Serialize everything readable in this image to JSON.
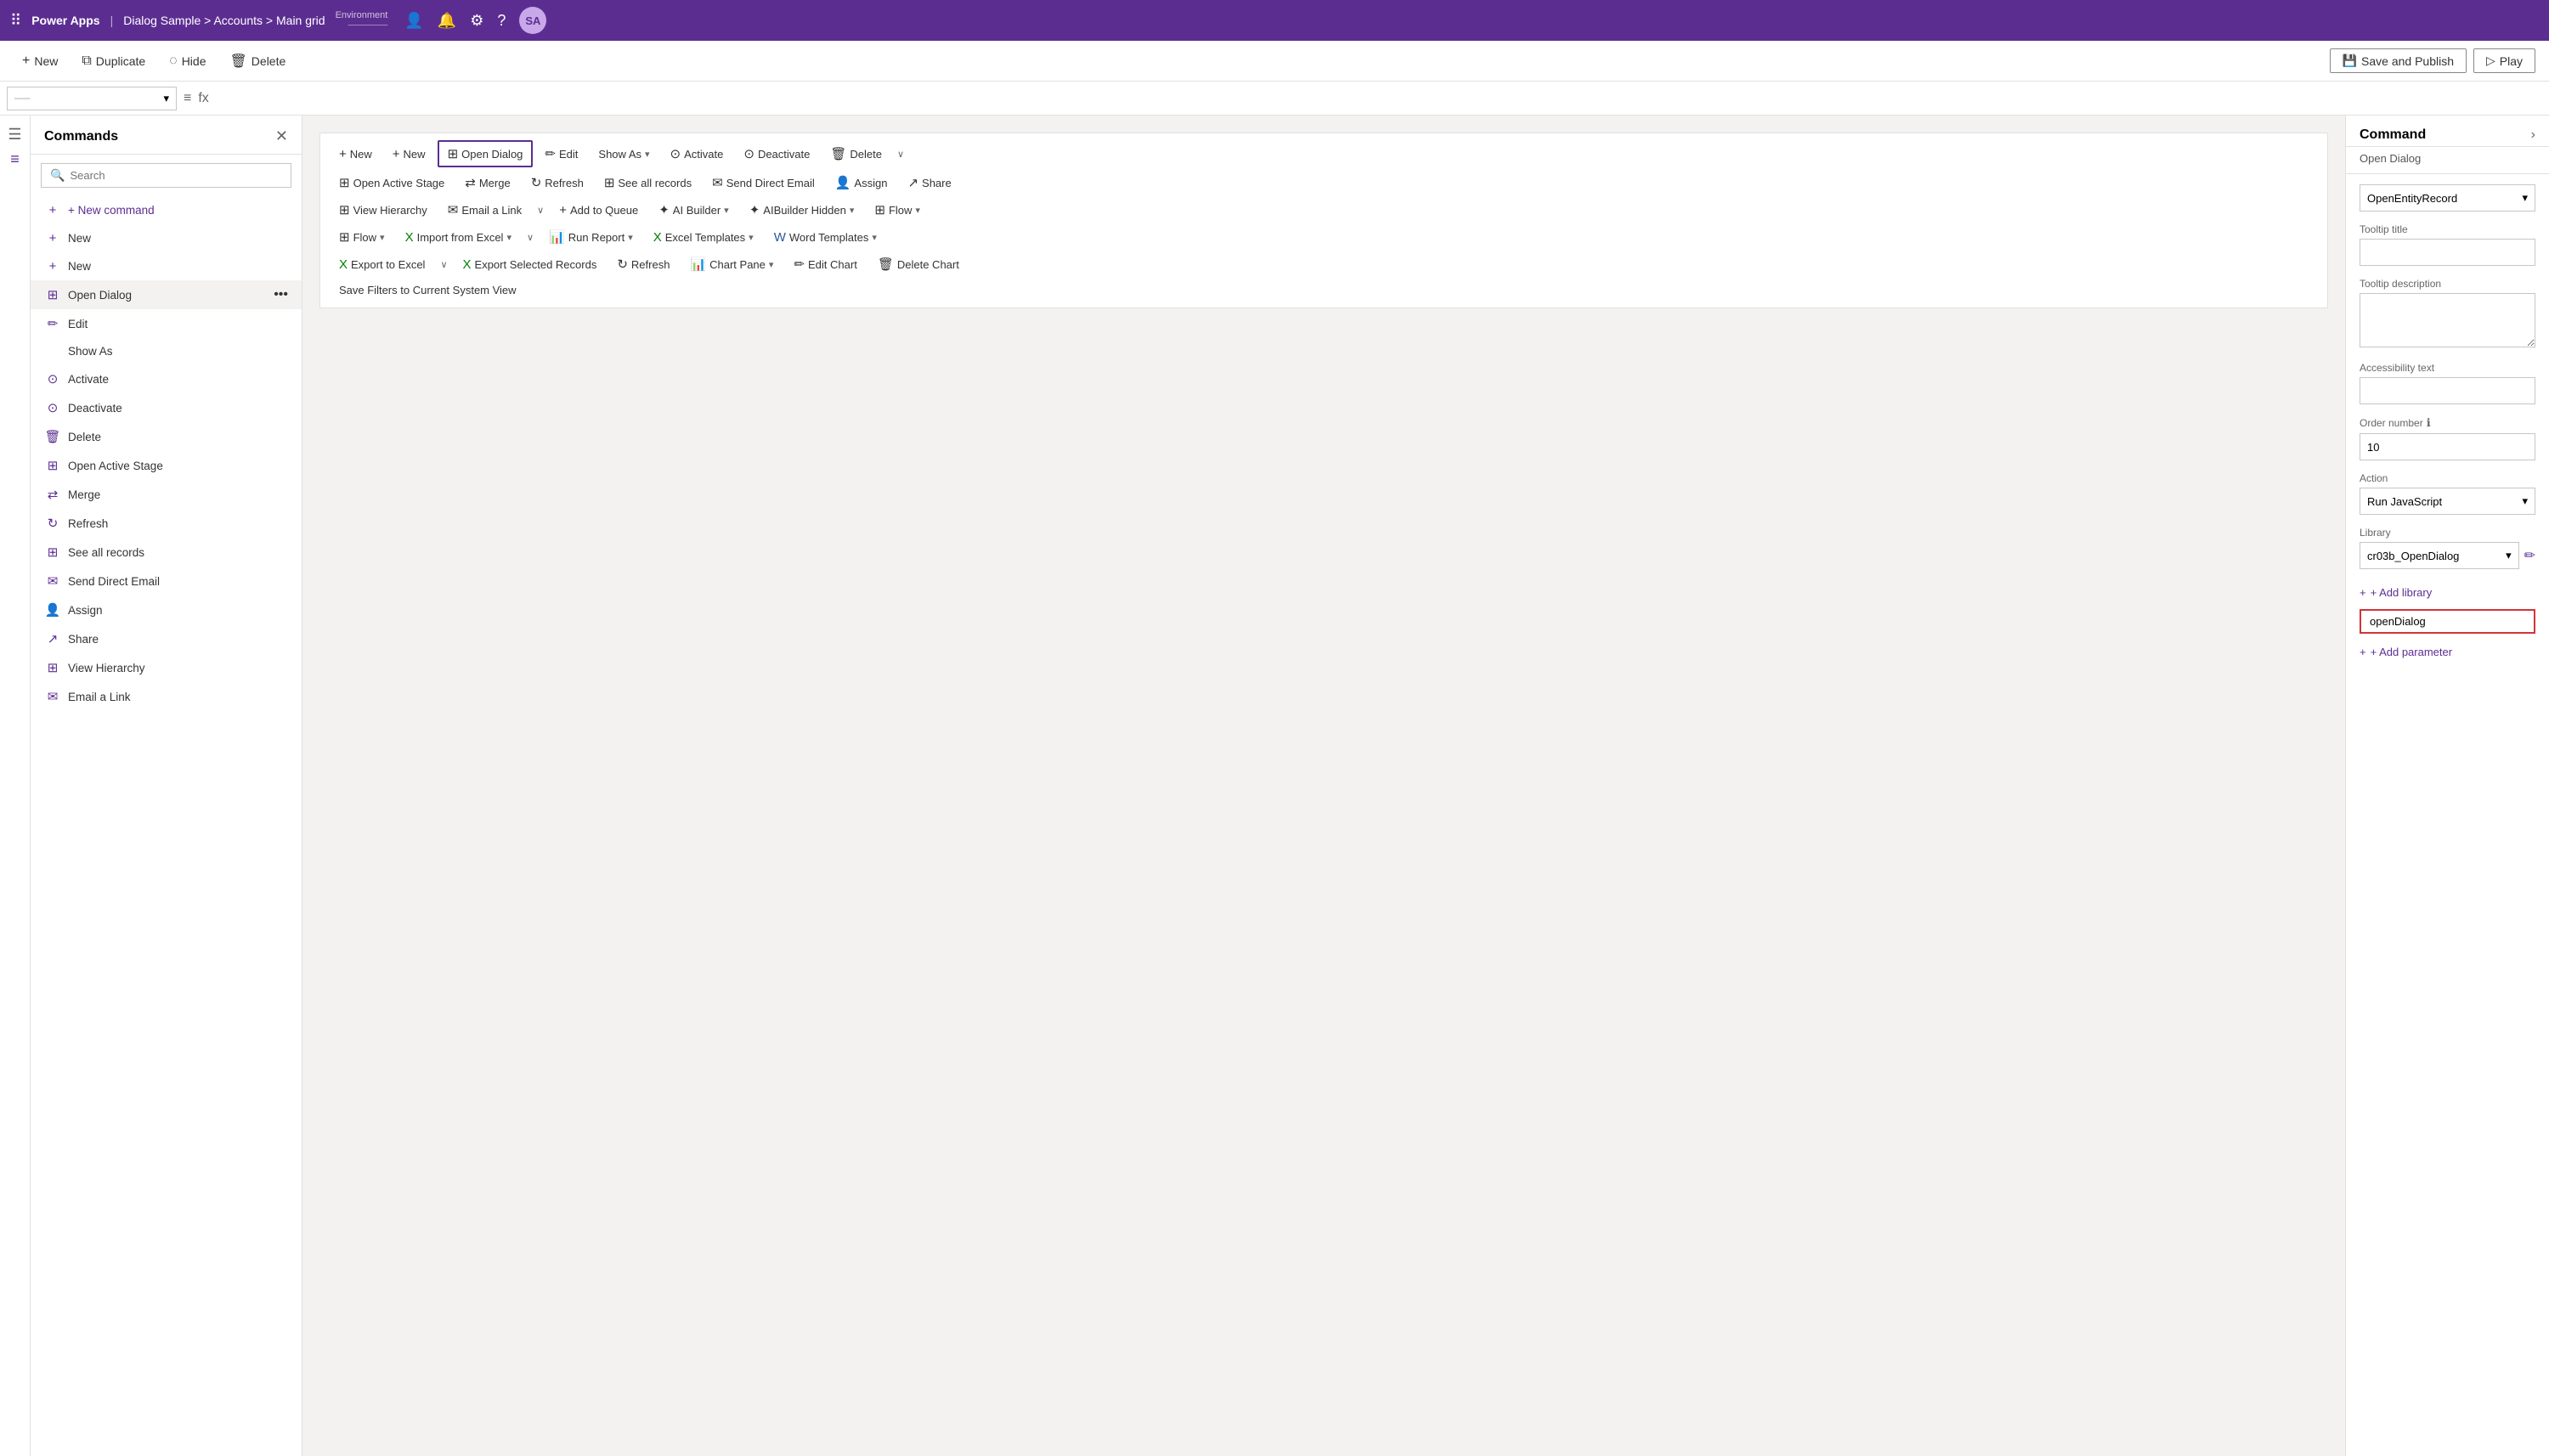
{
  "topNav": {
    "appName": "Power Apps",
    "separator": "|",
    "breadcrumb": "Dialog Sample > Accounts > Main grid",
    "environment": "Environment",
    "avatarText": "SA"
  },
  "toolbar": {
    "newLabel": "New",
    "duplicateLabel": "Duplicate",
    "hideLabel": "Hide",
    "deleteLabel": "Delete",
    "savePublishLabel": "Save and Publish",
    "playLabel": "Play"
  },
  "formulaBar": {
    "dropdownValue": "",
    "fxSymbol": "fx"
  },
  "commandsPanel": {
    "title": "Commands",
    "searchPlaceholder": "Search",
    "newCommandLabel": "+ New command",
    "items": [
      {
        "id": "new1",
        "icon": "+",
        "label": "New"
      },
      {
        "id": "new2",
        "icon": "+",
        "label": "New"
      },
      {
        "id": "open-dialog",
        "icon": "⊞",
        "label": "Open Dialog",
        "active": true
      },
      {
        "id": "edit",
        "icon": "✏",
        "label": "Edit"
      },
      {
        "id": "show-as",
        "icon": "",
        "label": "Show As",
        "indent": true
      },
      {
        "id": "activate",
        "icon": "⊙",
        "label": "Activate"
      },
      {
        "id": "deactivate",
        "icon": "⊙",
        "label": "Deactivate"
      },
      {
        "id": "delete",
        "icon": "🗑",
        "label": "Delete"
      },
      {
        "id": "open-active-stage",
        "icon": "⊞",
        "label": "Open Active Stage"
      },
      {
        "id": "merge",
        "icon": "⇄",
        "label": "Merge"
      },
      {
        "id": "refresh",
        "icon": "↻",
        "label": "Refresh"
      },
      {
        "id": "see-all-records",
        "icon": "⊞",
        "label": "See all records"
      },
      {
        "id": "send-direct-email",
        "icon": "✉",
        "label": "Send Direct Email"
      },
      {
        "id": "assign",
        "icon": "👤",
        "label": "Assign"
      },
      {
        "id": "share",
        "icon": "↗",
        "label": "Share"
      },
      {
        "id": "view-hierarchy",
        "icon": "⊞",
        "label": "View Hierarchy"
      },
      {
        "id": "email-a-link",
        "icon": "✉",
        "label": "Email a Link"
      }
    ]
  },
  "ribbon": {
    "row1": [
      {
        "id": "new-r1",
        "icon": "+",
        "label": "New"
      },
      {
        "id": "new-r2",
        "icon": "+",
        "label": "New"
      },
      {
        "id": "open-dialog-r",
        "icon": "⊞",
        "label": "Open Dialog",
        "active": true
      },
      {
        "id": "edit-r",
        "icon": "✏",
        "label": "Edit"
      },
      {
        "id": "show-as-r",
        "icon": "",
        "label": "Show As",
        "dropdown": true
      },
      {
        "id": "activate-r",
        "icon": "⊙",
        "label": "Activate"
      },
      {
        "id": "deactivate-r",
        "icon": "⊙",
        "label": "Deactivate"
      },
      {
        "id": "delete-r",
        "icon": "🗑",
        "label": "Delete"
      },
      {
        "id": "more-r1",
        "icon": "∨",
        "label": ""
      }
    ],
    "row2": [
      {
        "id": "open-active-stage-r",
        "icon": "⊞",
        "label": "Open Active Stage"
      },
      {
        "id": "merge-r",
        "icon": "⇄",
        "label": "Merge"
      },
      {
        "id": "refresh-r",
        "icon": "↻",
        "label": "Refresh"
      },
      {
        "id": "see-all-records-r",
        "icon": "⊞",
        "label": "See all records"
      },
      {
        "id": "send-direct-email-r",
        "icon": "✉",
        "label": "Send Direct Email"
      },
      {
        "id": "assign-r",
        "icon": "👤",
        "label": "Assign"
      },
      {
        "id": "share-r",
        "icon": "↗",
        "label": "Share"
      }
    ],
    "row3": [
      {
        "id": "view-hierarchy-r",
        "icon": "⊞",
        "label": "View Hierarchy"
      },
      {
        "id": "email-a-link-r",
        "icon": "✉",
        "label": "Email a Link"
      },
      {
        "id": "more-r3",
        "icon": "∨",
        "label": ""
      },
      {
        "id": "add-to-queue-r",
        "icon": "+",
        "label": "Add to Queue"
      },
      {
        "id": "ai-builder-r",
        "icon": "✦",
        "label": "AI Builder",
        "dropdown": true
      },
      {
        "id": "aibuilder-hidden-r",
        "icon": "✦",
        "label": "AIBuilder Hidden",
        "dropdown": true
      },
      {
        "id": "flow-r",
        "icon": "⊞",
        "label": "Flow",
        "dropdown": true
      }
    ],
    "row4": [
      {
        "id": "flow-r2",
        "icon": "⊞",
        "label": "Flow",
        "dropdown": true
      },
      {
        "id": "import-excel-r",
        "icon": "X",
        "label": "Import from Excel",
        "dropdown": true
      },
      {
        "id": "more-r4",
        "icon": "∨",
        "label": ""
      },
      {
        "id": "run-report-r",
        "icon": "📊",
        "label": "Run Report",
        "dropdown": true
      },
      {
        "id": "excel-templates-r",
        "icon": "X",
        "label": "Excel Templates",
        "dropdown": true
      },
      {
        "id": "word-templates-r",
        "icon": "W",
        "label": "Word Templates",
        "dropdown": true
      }
    ],
    "row5": [
      {
        "id": "export-excel-r",
        "icon": "X",
        "label": "Export to Excel",
        "dropdown": true
      },
      {
        "id": "more-r5",
        "icon": "∨",
        "label": ""
      },
      {
        "id": "export-selected-r",
        "icon": "X",
        "label": "Export Selected Records"
      },
      {
        "id": "refresh-r2",
        "icon": "↻",
        "label": "Refresh"
      },
      {
        "id": "chart-pane-r",
        "icon": "📊",
        "label": "Chart Pane",
        "dropdown": true
      },
      {
        "id": "edit-chart-r",
        "icon": "✏",
        "label": "Edit Chart"
      },
      {
        "id": "delete-chart-r",
        "icon": "🗑",
        "label": "Delete Chart"
      }
    ],
    "row6": [
      {
        "id": "save-filters-r",
        "icon": "",
        "label": "Save Filters to Current System View"
      }
    ]
  },
  "rightPanel": {
    "title": "Command",
    "subtitle": "Open Dialog",
    "actionDropdownLabel": "OpenEntityRecord",
    "tooltipTitle": "Tooltip title",
    "tooltipTitleValue": "",
    "tooltipDescription": "Tooltip description",
    "tooltipDescriptionValue": "",
    "accessibilityText": "Accessibility text",
    "accessibilityTextValue": "",
    "orderNumber": "Order number",
    "orderNumberValue": "10",
    "action": "Action",
    "actionValue": "Run JavaScript",
    "library": "Library",
    "libraryValue": "cr03b_OpenDialog",
    "addLibraryLabel": "+ Add library",
    "functionName": "openDialog",
    "addParameterLabel": "+ Add parameter"
  }
}
